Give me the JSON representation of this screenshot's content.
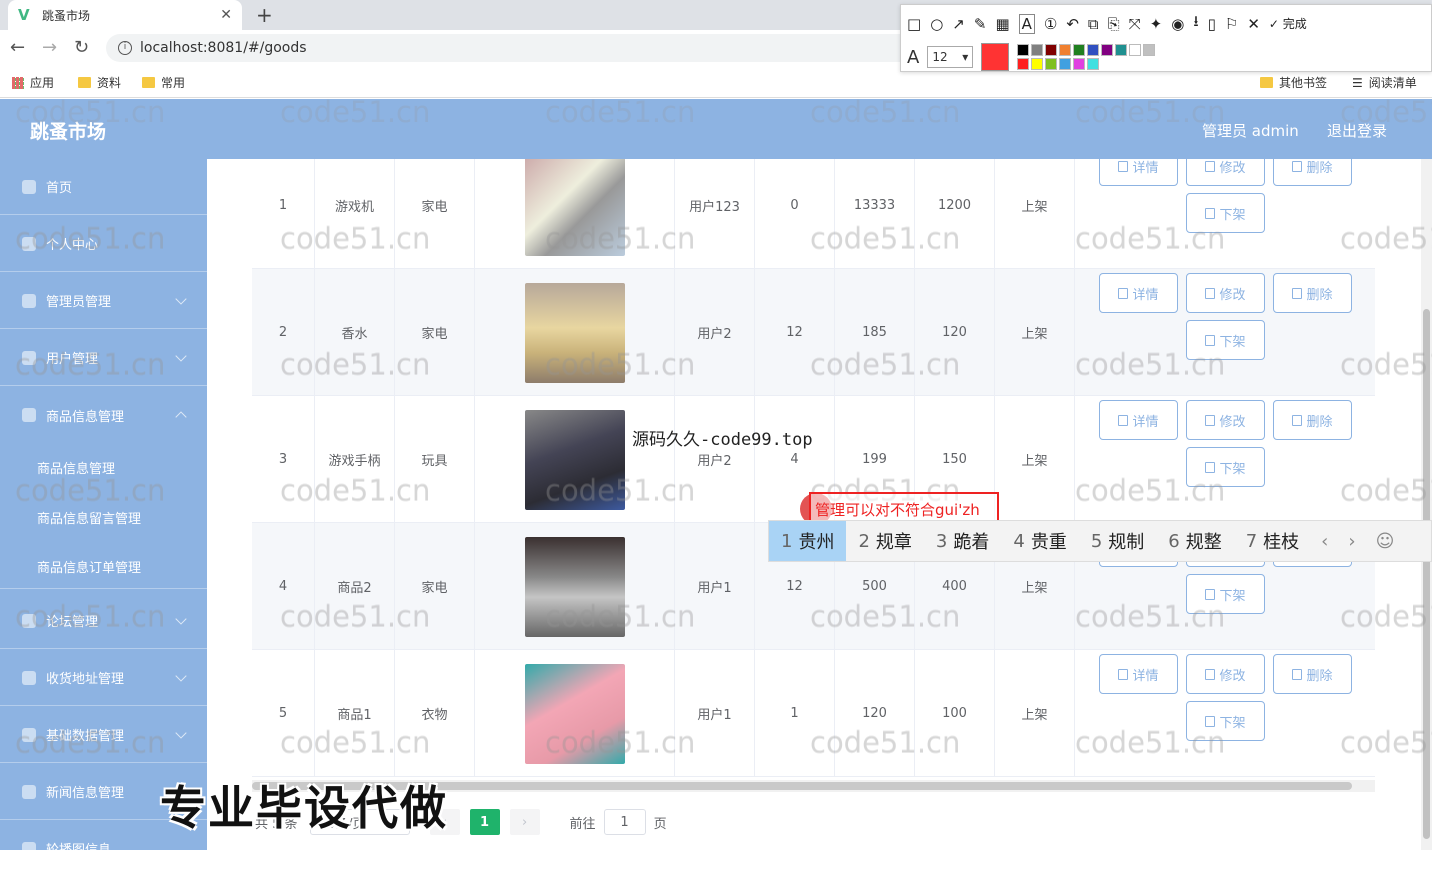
{
  "browser": {
    "tab_title": "跳蚤市场",
    "url": "localhost:8081/#/goods",
    "bookmarks": [
      "应用",
      "资料",
      "常用"
    ],
    "bookmarks_right": [
      "其他书签",
      "阅读清单"
    ]
  },
  "screenshot_tool": {
    "font_size": "12",
    "done_label": "完成",
    "current_color": "#f33333",
    "palette": [
      "#000000",
      "#808080",
      "#800000",
      "#f08030",
      "#208020",
      "#3050c0",
      "#800080",
      "#209090",
      "#ffffff",
      "#c0c0c0",
      "#ff2020",
      "#ffff00",
      "#80c020",
      "#40a0e0",
      "#e040e0",
      "#40e0e0"
    ]
  },
  "app": {
    "title": "跳蚤市场",
    "admin_label": "管理员 admin",
    "logout_label": "退出登录"
  },
  "sidebar": {
    "items": [
      {
        "label": "首页"
      },
      {
        "label": "个人中心"
      },
      {
        "label": "管理员管理"
      },
      {
        "label": "用户管理"
      },
      {
        "label": "商品信息管理"
      },
      {
        "label": "论坛管理"
      },
      {
        "label": "收货地址管理"
      },
      {
        "label": "基础数据管理"
      },
      {
        "label": "新闻信息管理"
      },
      {
        "label": "轮播图信息"
      }
    ],
    "sub_items": [
      "商品信息管理",
      "商品信息留言管理",
      "商品信息订单管理"
    ]
  },
  "table": {
    "rows": [
      {
        "index": "1",
        "name": "游戏机",
        "type": "家电",
        "user": "用户123",
        "stock": "0",
        "orig_price": "13333",
        "price": "1200",
        "status": "上架"
      },
      {
        "index": "2",
        "name": "香水",
        "type": "家电",
        "user": "用户2",
        "stock": "12",
        "orig_price": "185",
        "price": "120",
        "status": "上架"
      },
      {
        "index": "3",
        "name": "游戏手柄",
        "type": "玩具",
        "user": "用户2",
        "stock": "4",
        "orig_price": "199",
        "price": "150",
        "status": "上架"
      },
      {
        "index": "4",
        "name": "商品2",
        "type": "家电",
        "user": "用户1",
        "stock": "12",
        "orig_price": "500",
        "price": "400",
        "status": "上架"
      },
      {
        "index": "5",
        "name": "商品1",
        "type": "衣物",
        "user": "用户1",
        "stock": "1",
        "orig_price": "120",
        "price": "100",
        "status": "上架"
      }
    ],
    "buttons": {
      "detail": "详情",
      "edit": "修改",
      "delete": "删除",
      "offshelf": "下架"
    }
  },
  "pagination": {
    "total": "共 5 条",
    "page_size": "10条/页",
    "current_page": "1",
    "goto_label": "前往",
    "goto_value": "1",
    "page_unit": "页"
  },
  "overlays": {
    "watermark": "code51.cn",
    "promo_url": "源码久久-code99.top",
    "promo_big": "专业毕设代做",
    "annotation_text": "管理可以对不符合gui'zh",
    "ime_candidates": [
      {
        "n": "1",
        "w": "贵州"
      },
      {
        "n": "2",
        "w": "规章"
      },
      {
        "n": "3",
        "w": "跪着"
      },
      {
        "n": "4",
        "w": "贵重"
      },
      {
        "n": "5",
        "w": "规制"
      },
      {
        "n": "6",
        "w": "规整"
      },
      {
        "n": "7",
        "w": "桂枝"
      }
    ]
  }
}
